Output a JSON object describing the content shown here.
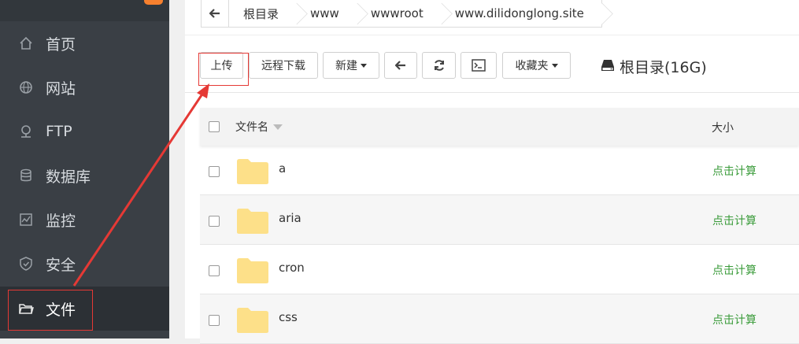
{
  "sidebar": {
    "items": [
      {
        "label": "首页",
        "icon": "home-icon"
      },
      {
        "label": "网站",
        "icon": "globe-icon"
      },
      {
        "label": "FTP",
        "icon": "ftp-icon"
      },
      {
        "label": "数据库",
        "icon": "database-icon"
      },
      {
        "label": "监控",
        "icon": "monitor-icon"
      },
      {
        "label": "安全",
        "icon": "shield-icon"
      },
      {
        "label": "文件",
        "icon": "folder-icon",
        "active": true
      }
    ]
  },
  "breadcrumb": [
    "根目录",
    "www",
    "wwwroot",
    "www.dilidonglong.site"
  ],
  "toolbar": {
    "upload_label": "上传",
    "remote_download_label": "远程下载",
    "new_label": "新建",
    "favorites_label": "收藏夹",
    "disk_label": "根目录(16G)"
  },
  "table": {
    "headers": {
      "name": "文件名",
      "size": "大小"
    },
    "rows": [
      {
        "name": "a",
        "size": "点击计算"
      },
      {
        "name": "aria",
        "size": "点击计算"
      },
      {
        "name": "cron",
        "size": "点击计算"
      },
      {
        "name": "css",
        "size": "点击计算"
      }
    ]
  },
  "colors": {
    "accent": "#e53935",
    "sidebar": "#3a3f45",
    "size_link": "#3a9b3a",
    "folder": "#fde089"
  }
}
